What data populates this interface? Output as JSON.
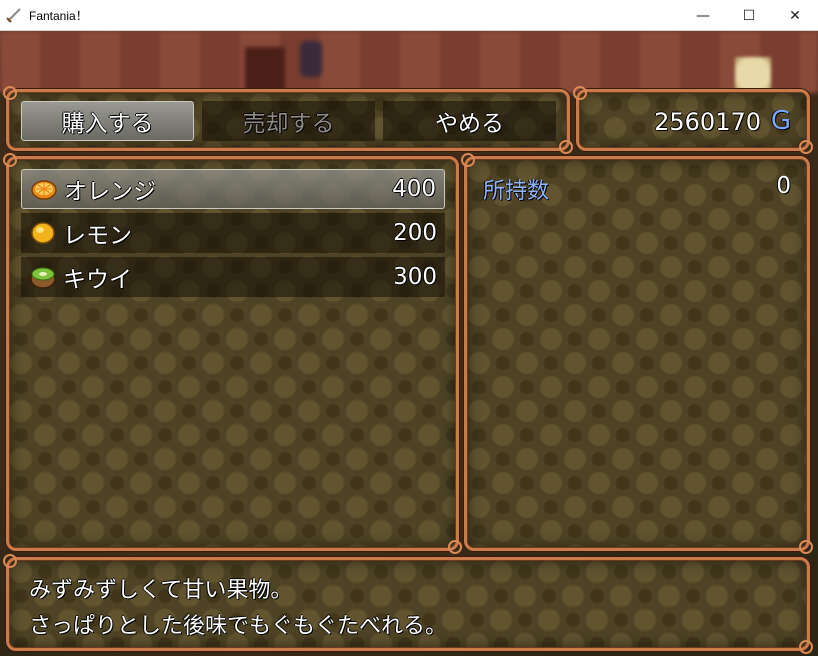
{
  "window": {
    "title": "Fantania！",
    "icon": "sword-icon",
    "controls": {
      "minimize": "—",
      "maximize": "☐",
      "close": "✕"
    }
  },
  "commands": {
    "buy": "購入する",
    "sell": "売却する",
    "cancel": "やめる",
    "selected": "buy"
  },
  "gold": {
    "amount": "2560170",
    "unit": "G"
  },
  "items": [
    {
      "name": "オレンジ",
      "price": "400",
      "icon": "orange-slice-icon",
      "selected": true
    },
    {
      "name": "レモン",
      "price": "200",
      "icon": "lemon-icon",
      "selected": false
    },
    {
      "name": "キウイ",
      "price": "300",
      "icon": "kiwi-icon",
      "selected": false
    }
  ],
  "status": {
    "owned_label": "所持数",
    "owned_value": "0"
  },
  "help": {
    "line1": "みずみずしくて甘い果物。",
    "line2": "さっぱりとした後味でもぐもぐたべれる。"
  },
  "colors": {
    "frame": "#c97b4a",
    "panel_bg": "#4e4324",
    "gold_unit": "#7aa6ff",
    "label_blue": "#8fb6ff"
  }
}
